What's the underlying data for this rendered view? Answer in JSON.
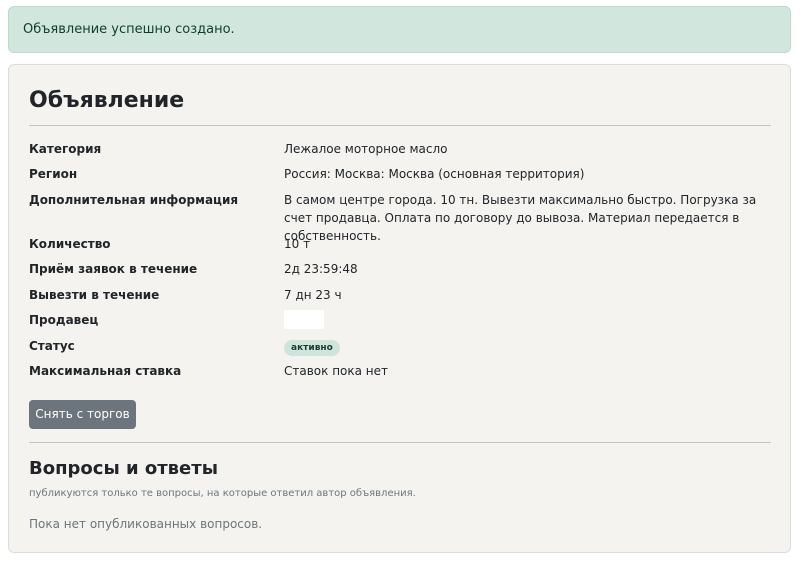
{
  "alert": {
    "message": "Объявление успешно создано."
  },
  "card": {
    "title": "Объявление",
    "rows": [
      {
        "label": "Категория",
        "value": "Лежалое моторное масло"
      },
      {
        "label": "Регион",
        "value": "Россия: Москва: Москва (основная территория)"
      },
      {
        "label": "Дополнительная информация",
        "value": "В самом центре города. 10 тн. Вывезти максимально быстро. Погрузка за счет продавца. Оплата по договору до вывоза. Материал передается в собственность."
      },
      {
        "label": "Количество",
        "value": "10 т"
      },
      {
        "label": "Приём заявок в течение",
        "value": "2д 23:59:48"
      },
      {
        "label": "Вывезти в течение",
        "value": "7 дн 23 ч"
      },
      {
        "label": "Продавец",
        "value": ""
      },
      {
        "label": "Статус",
        "value": "активно"
      },
      {
        "label": "Максимальная ставка",
        "value": "Ставок пока нет"
      }
    ],
    "withdraw_button": "Снять с торгов"
  },
  "qa": {
    "title": "Вопросы и ответы",
    "note": "публикуются только те вопросы, на которые ответил автор объявления.",
    "empty": "Пока нет опубликованных вопросов."
  },
  "colors": {
    "alert_bg": "#d1e7dd",
    "card_bg": "#f4f3ef",
    "button_bg": "#6c757d",
    "status_badge_bg": "#cfe4dc"
  }
}
